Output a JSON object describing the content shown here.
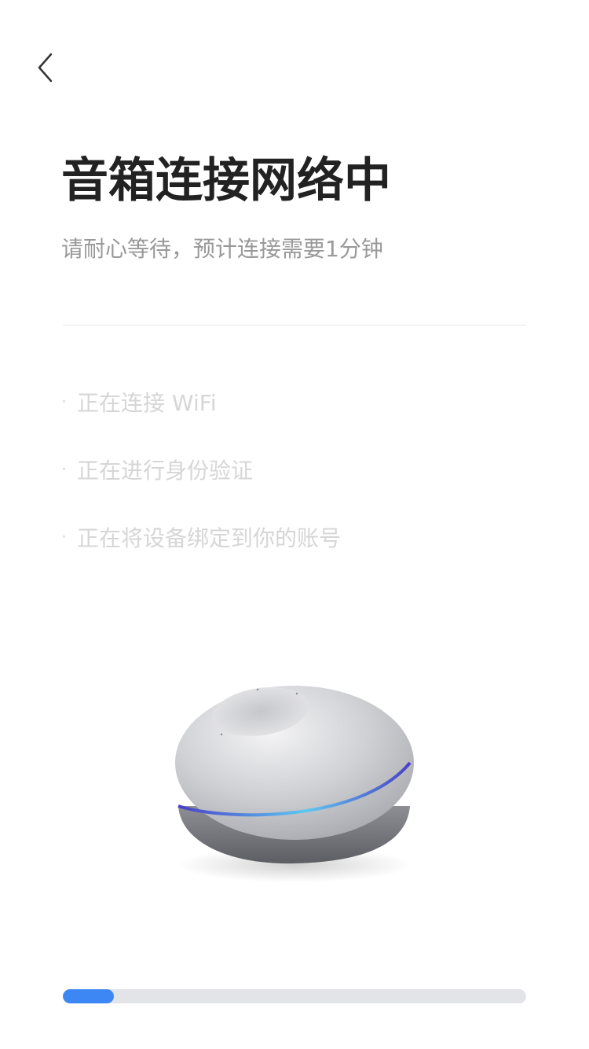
{
  "nav": {
    "back_icon": "chevron-left-icon"
  },
  "header": {
    "title": "音箱连接网络中",
    "subtitle": "请耐心等待，预计连接需要1分钟"
  },
  "steps": [
    {
      "bullet": "·",
      "label": "正在连接 WiFi"
    },
    {
      "bullet": "·",
      "label": "正在进行身份验证"
    },
    {
      "bullet": "·",
      "label": "正在将设备绑定到你的账号"
    }
  ],
  "device": {
    "image": "smart-speaker-image"
  },
  "progress": {
    "value": 0.11
  },
  "colors": {
    "title": "#222222",
    "subtitle": "#999999",
    "step_inactive": "#d6d6d6",
    "divider": "#e6e6e6",
    "progress_track": "#e3e4e8",
    "progress_fill": "#3d87f5",
    "speaker_light": "#5a4fd6"
  }
}
